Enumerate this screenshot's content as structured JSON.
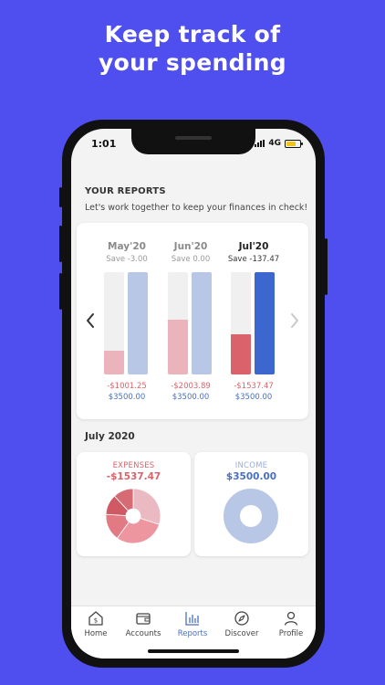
{
  "promo": {
    "line1": "Keep track of",
    "line2": "your spending"
  },
  "status": {
    "time": "1:01",
    "network": "4G"
  },
  "reports": {
    "title": "YOUR REPORTS",
    "subtitle": "Let's work together to keep your finances in check!",
    "months": [
      {
        "label": "May'20",
        "save": "Save -3.00",
        "expenses": "-$1001.25",
        "income": "$3500.00",
        "expense_fraction": 0.23,
        "income_fraction": 1.0,
        "active": false
      },
      {
        "label": "Jun'20",
        "save": "Save 0.00",
        "expenses": "-$2003.89",
        "income": "$3500.00",
        "expense_fraction": 0.54,
        "income_fraction": 1.0,
        "active": false
      },
      {
        "label": "Jul'20",
        "save": "Save -137.47",
        "expenses": "-$1537.47",
        "income": "$3500.00",
        "expense_fraction": 0.39,
        "income_fraction": 1.0,
        "active": true
      }
    ]
  },
  "month_summary": {
    "heading": "July 2020",
    "expenses_label": "EXPENSES",
    "expenses_value": "-$1537.47",
    "income_label": "INCOME",
    "income_value": "$3500.00"
  },
  "expense_slices": [
    0.3,
    0.3,
    0.16,
    0.12,
    0.12
  ],
  "tabs": [
    {
      "label": "Home",
      "icon": "home-dollar-icon",
      "active": false
    },
    {
      "label": "Accounts",
      "icon": "wallet-icon",
      "active": false
    },
    {
      "label": "Reports",
      "icon": "bar-chart-icon",
      "active": true
    },
    {
      "label": "Discover",
      "icon": "compass-icon",
      "active": false
    },
    {
      "label": "Profile",
      "icon": "person-icon",
      "active": false
    }
  ],
  "colors": {
    "background": "#4f4ff0",
    "expense_light": "#ebb3bb",
    "expense_active": "#d9626b",
    "income_light": "#b9c7e6",
    "income_active": "#3b67cf",
    "expense_text": "#d9626b",
    "income_text": "#4a6fc0",
    "active_tab": "#4a6fc0"
  }
}
